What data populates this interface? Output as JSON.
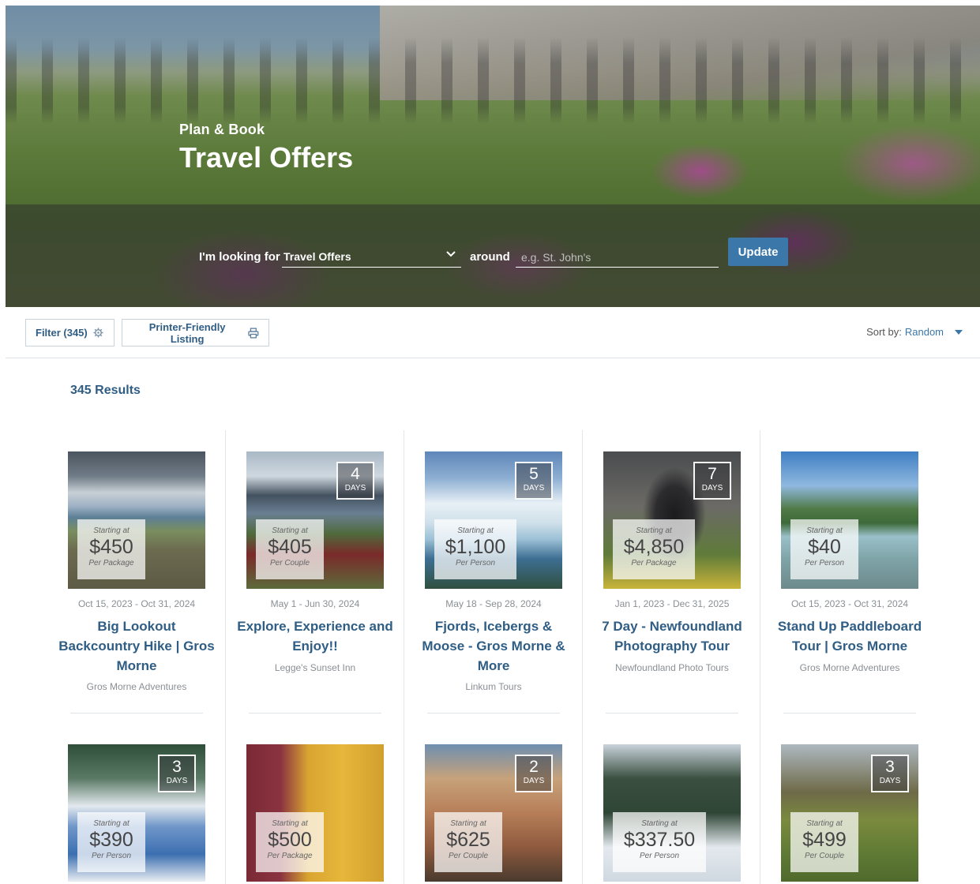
{
  "hero": {
    "kicker": "Plan & Book",
    "title": "Travel Offers"
  },
  "search": {
    "looking_label": "I'm looking for",
    "category_value": "Travel Offers",
    "around_label": "around",
    "location_placeholder": "e.g. St. John's",
    "update_label": "Update"
  },
  "toolbar": {
    "filter_label": "Filter (345)",
    "filter_icon": "settings-icon",
    "print_label": "Printer-Friendly Listing",
    "print_icon": "printer-icon",
    "sort_label": "Sort by:",
    "sort_value": "Random"
  },
  "results_label": "345 Results",
  "colors": {
    "link": "#2f5d84",
    "accent": "#3b77a8",
    "muted": "#8a8f94"
  },
  "cards": [
    {
      "starting": "Starting at",
      "price": "$450",
      "unit": "Per Package",
      "days": "",
      "days_label": "",
      "dates": "Oct 15, 2023 - Oct 31, 2024",
      "title": "Big Lookout Backcountry Hike | Gros Morne",
      "vendor": "Gros Morne Adventures"
    },
    {
      "starting": "Starting at",
      "price": "$405",
      "unit": "Per Couple",
      "days": "4",
      "days_label": "DAYS",
      "dates": "May 1 - Jun 30, 2024",
      "title": "Explore, Experience and Enjoy!!",
      "vendor": "Legge's Sunset Inn"
    },
    {
      "starting": "Starting at",
      "price": "$1,100",
      "unit": "Per Person",
      "days": "5",
      "days_label": "DAYS",
      "dates": "May 18 - Sep 28, 2024",
      "title": "Fjords, Icebergs & Moose - Gros Morne & More",
      "vendor": "Linkum Tours"
    },
    {
      "starting": "Starting at",
      "price": "$4,850",
      "unit": "Per Package",
      "days": "7",
      "days_label": "DAYS",
      "dates": "Jan 1, 2023 - Dec 31, 2025",
      "title": "7 Day - Newfoundland Photography Tour",
      "vendor": "Newfoundland Photo Tours"
    },
    {
      "starting": "Starting at",
      "price": "$40",
      "unit": "Per Person",
      "days": "",
      "days_label": "",
      "dates": "Oct 15, 2023 - Oct 31, 2024",
      "title": "Stand Up Paddleboard Tour | Gros Morne",
      "vendor": "Gros Morne Adventures"
    },
    {
      "starting": "Starting at",
      "price": "$390",
      "unit": "Per Person",
      "days": "3",
      "days_label": "DAYS"
    },
    {
      "starting": "Starting at",
      "price": "$500",
      "unit": "Per Package",
      "days": "",
      "days_label": ""
    },
    {
      "starting": "Starting at",
      "price": "$625",
      "unit": "Per Couple",
      "days": "2",
      "days_label": "DAYS"
    },
    {
      "starting": "Starting at",
      "price": "$337.50",
      "unit": "Per Person",
      "days": "",
      "days_label": ""
    },
    {
      "starting": "Starting at",
      "price": "$499",
      "unit": "Per Couple",
      "days": "3",
      "days_label": "DAYS"
    }
  ]
}
